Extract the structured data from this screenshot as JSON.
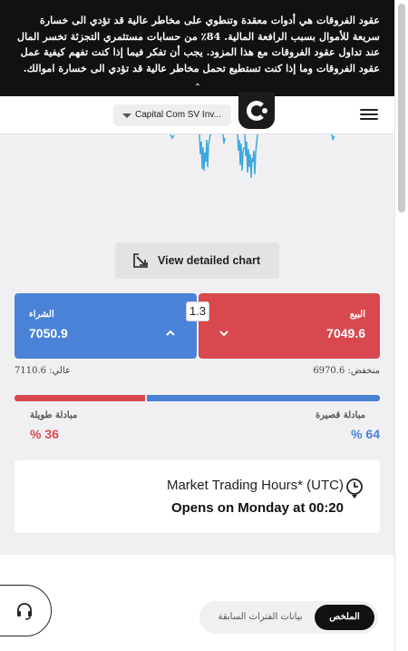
{
  "risk_warning": {
    "text": "عقود الفروقات هي أدوات معقدة وتنطوي على مخاطر عالية قد تؤدي الى خسارة سريعة للأموال بسبب الرافعة المالية. 84٪ من حسابات مستثمري التجزئة تخسر المال عند تداول عقود الفروقات مع هذا المزود. يجب أن تفكر فيما إذا كنت تفهم كيفية عمل عقود الفروقات وما إذا كنت تستطيع تحمل مخاطر عالية قد تؤدي الى خسارة اموالك."
  },
  "header": {
    "account_selector": "Capital Com SV Inv...",
    "logo_icon": "capital-com-logo",
    "menu_icon": "hamburger-menu-icon"
  },
  "chart": {
    "detail_button_label": "View detailed chart",
    "detail_icon": "expand-arrow-icon"
  },
  "trade": {
    "buy_label": "الشراء",
    "buy_price": "7050.9",
    "sell_label": "البيع",
    "sell_price": "7049.6",
    "spread": "1.3",
    "high": "عالي: 7110.6",
    "low": "منخفض: 6970.6"
  },
  "sentiment": {
    "long_swap_label": "مبادلة طويلة",
    "long_percent_text": "% 36",
    "short_swap_label": "مبادلة قصيرة",
    "short_percent_text": "% 64",
    "long_fraction": 0.36,
    "short_fraction": 0.64
  },
  "market_hours": {
    "title": "Market Trading Hours* (UTC)",
    "status": "Opens on Monday at 00:20",
    "icon": "clock-icon"
  },
  "support": {
    "icon": "headset-icon"
  },
  "tabs": {
    "summary": "الملخص",
    "history": "بيانات الفترات السابقة"
  },
  "colors": {
    "buy": "#4a82d8",
    "sell": "#d9484e",
    "chart_line": "#3ba9e0",
    "warning_bg": "#111111"
  }
}
